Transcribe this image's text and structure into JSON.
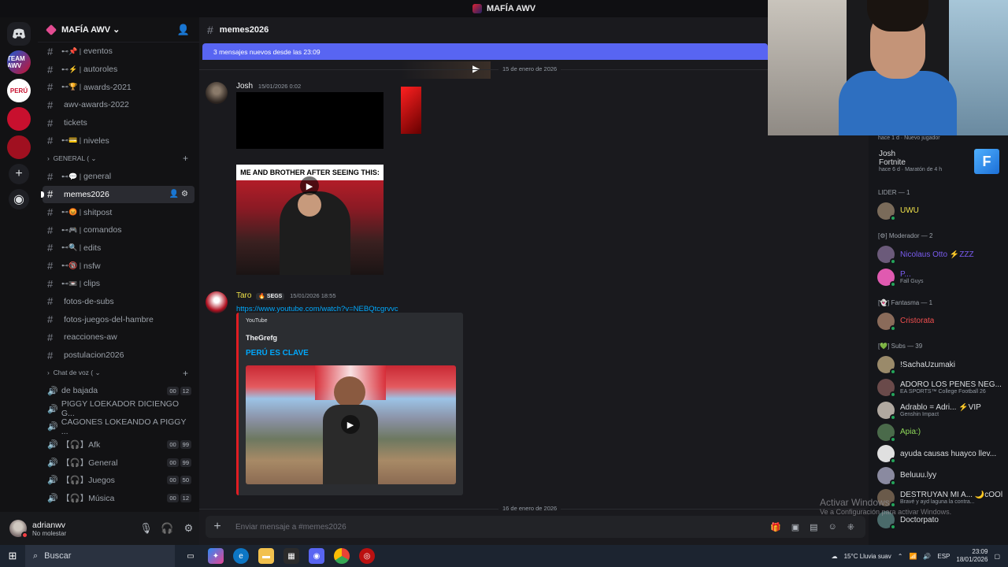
{
  "window": {
    "title": "MAFÍA AWV"
  },
  "rail": {
    "servers": [
      "TEAM AWV",
      "PERÚ"
    ]
  },
  "server": {
    "name": "MAFÍA AWV"
  },
  "channels": {
    "top": [
      {
        "name": "eventos",
        "emoji": "⊷📌 |"
      },
      {
        "name": "autoroles",
        "emoji": "⊷⚡ |"
      },
      {
        "name": "awards-2021",
        "emoji": "⊷🏆 |"
      },
      {
        "name": "awv-awards-2022",
        "emoji": ""
      },
      {
        "name": "tickets",
        "emoji": ""
      },
      {
        "name": "niveles",
        "emoji": "⊷💳 |"
      }
    ],
    "cat_general": "GENERAL",
    "general": [
      {
        "name": "general",
        "emoji": "⊷💬 |"
      },
      {
        "name": "memes2026",
        "emoji": ""
      },
      {
        "name": "shitpost",
        "emoji": "⊷😡 |"
      },
      {
        "name": "comandos",
        "emoji": "⊷🎮 |"
      },
      {
        "name": "edits",
        "emoji": "⊷🔍 |"
      },
      {
        "name": "nsfw",
        "emoji": "⊷🔞 |"
      },
      {
        "name": "clips",
        "emoji": "⊷📼 |"
      },
      {
        "name": "fotos-de-subs",
        "emoji": ""
      },
      {
        "name": "fotos-juegos-del-hambre",
        "emoji": ""
      },
      {
        "name": "reacciones-aw",
        "emoji": ""
      },
      {
        "name": "postulacion2026",
        "emoji": ""
      }
    ],
    "cat_voice": "Chat de voz",
    "voice": [
      {
        "name": "de bajada",
        "a": "00",
        "b": "12"
      },
      {
        "name": "PIGGY LOEKADOR DICIENGO G...",
        "a": "",
        "b": ""
      },
      {
        "name": "CAGONES LOKEANDO A PIGGY ...",
        "a": "",
        "b": ""
      },
      {
        "name": "【🎧】Afk",
        "a": "00",
        "b": "99"
      },
      {
        "name": "【🎧】General",
        "a": "00",
        "b": "99"
      },
      {
        "name": "【🎧】Juegos",
        "a": "00",
        "b": "50"
      },
      {
        "name": "【🎧】Música",
        "a": "00",
        "b": "12"
      }
    ]
  },
  "user": {
    "name": "adrianwv",
    "status": "No molestar"
  },
  "main": {
    "channel": "memes2026",
    "new_messages": "3 mensajes nuevos desde las 23:09",
    "date1": "15 de enero de 2026",
    "date2": "16 de enero de 2026",
    "msg1": {
      "author": "Josh",
      "time": "15/01/2026 0:02",
      "caption": "ME AND BROTHER AFTER SEEING THIS:"
    },
    "msg2": {
      "author": "Taro",
      "tag": "🔥 SEGS",
      "time": "15/01/2026 18:55",
      "link": "https://www.youtube.com/watch?v=NEBQtcgrvvc",
      "provider": "YouTube",
      "embed_author": "TheGrefg",
      "embed_title": "PERÚ ES CLAVE"
    },
    "composer_placeholder": "Enviar mensaje a #memes2026"
  },
  "members": {
    "top_activity": "hace 1 d  ·  Nuevo jugador",
    "josh": {
      "name": "Josh",
      "game": "Fortnite",
      "activity": "hace 6 d  ·  Maratón de 4 h"
    },
    "groups": [
      {
        "label": "LIDER — 1",
        "members": [
          {
            "name": "UWU",
            "act": "",
            "color": "#f0e24a"
          }
        ]
      },
      {
        "label": "[⚙] Moderador — 2",
        "members": [
          {
            "name": "Nicolaus Otto ⚡ZZZ",
            "act": "",
            "color": "#7a5cf0"
          },
          {
            "name": "P...",
            "act": "Fall Guys",
            "color": "#7a5cf0"
          }
        ]
      },
      {
        "label": "[👻] Fantasma — 1",
        "members": [
          {
            "name": "Cristorata",
            "act": "",
            "color": "#f04f4f"
          }
        ]
      },
      {
        "label": "[💚] Subs — 39",
        "members": [
          {
            "name": "!SachaUzumaki",
            "act": "",
            "color": "#dbdee1"
          },
          {
            "name": "ADORO LOS PENES NEG...",
            "act": "EA SPORTS™ College Football 26",
            "color": "#dbdee1"
          },
          {
            "name": "Adrablo = Adri... ⚡VIP",
            "act": "Genshin Impact",
            "color": "#dbdee1"
          },
          {
            "name": "Apia:)",
            "act": "",
            "color": "#8fd95a"
          },
          {
            "name": "ayuda causas huayco llev...",
            "act": "",
            "color": "#dbdee1"
          },
          {
            "name": "Beluuu.lyy",
            "act": "",
            "color": "#dbdee1"
          },
          {
            "name": "DESTRUYAN MI A... 🌙cOOl",
            "act": "Bravé y ayd laguna la contra...",
            "color": "#dbdee1"
          },
          {
            "name": "Doctorpato",
            "act": "",
            "color": "#dbdee1"
          }
        ]
      }
    ]
  },
  "watermark": {
    "title": "Activar Windows",
    "sub": "Ve a Configuración para activar Windows."
  },
  "taskbar": {
    "search": "Buscar",
    "weather": "15°C  Lluvia suav",
    "lang": "ESP",
    "time": "23:09",
    "date": "18/01/2026"
  }
}
